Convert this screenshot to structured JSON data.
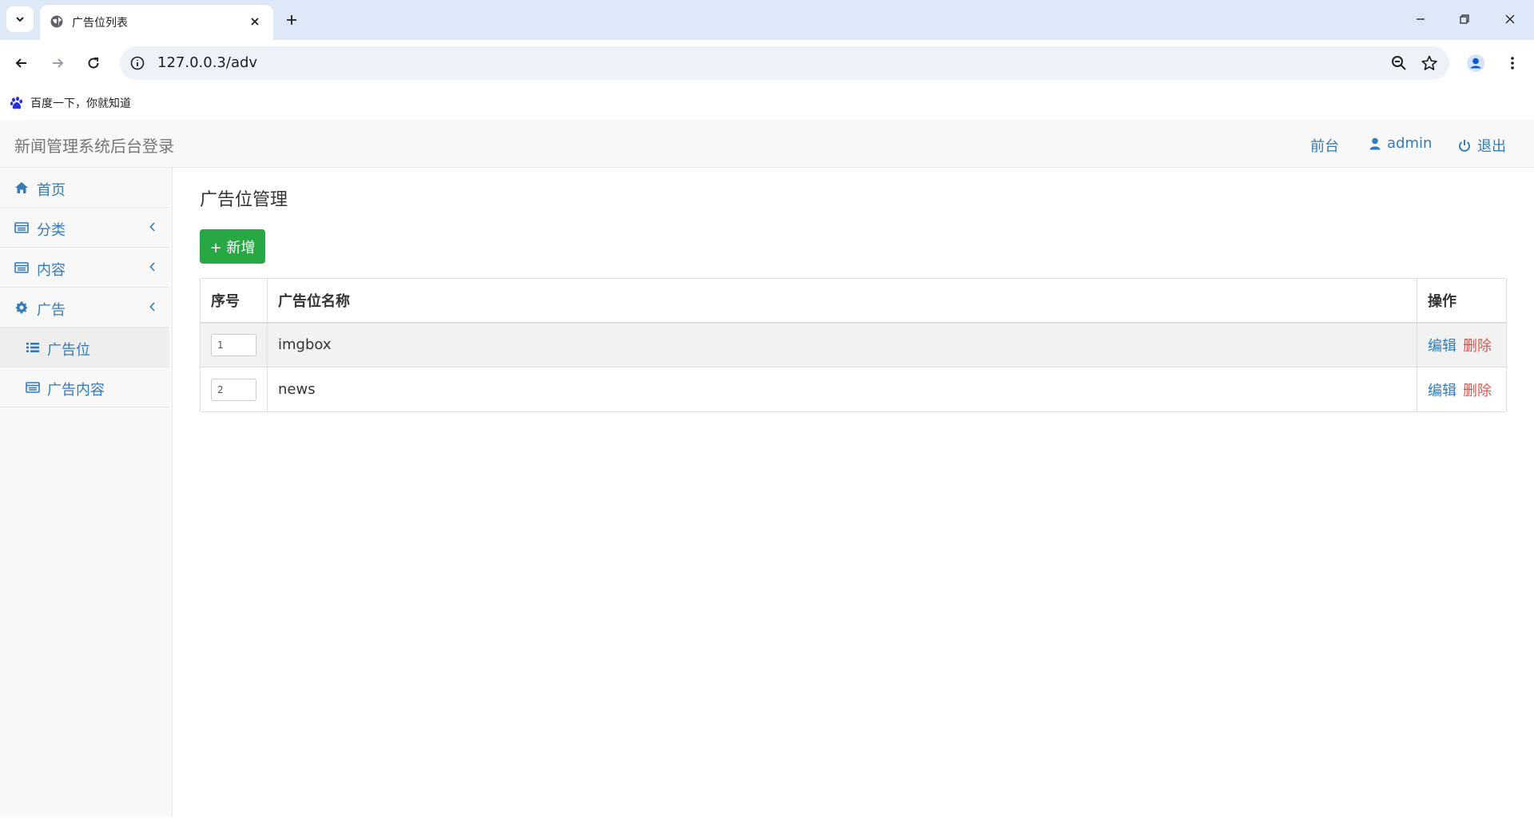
{
  "browser": {
    "tab_title": "广告位列表",
    "url": "127.0.0.3/adv",
    "bookmark_label": "百度一下，你就知道"
  },
  "app": {
    "brand": "新闻管理系统后台登录",
    "nav_right": {
      "frontend": "前台",
      "user": "admin",
      "logout": "退出"
    },
    "sidebar": {
      "items": [
        {
          "label": "首页",
          "icon": "home-icon"
        },
        {
          "label": "分类",
          "icon": "list-table-icon"
        },
        {
          "label": "内容",
          "icon": "list-table-icon"
        },
        {
          "label": "广告",
          "icon": "gear-icon"
        }
      ],
      "sub_items": [
        {
          "label": "广告位",
          "icon": "list-icon",
          "active": true
        },
        {
          "label": "广告内容",
          "icon": "list-table-icon",
          "active": false
        }
      ]
    },
    "main": {
      "title": "广告位管理",
      "add_button": "+ 新增",
      "table": {
        "headers": [
          "序号",
          "广告位名称",
          "操作"
        ],
        "rows": [
          {
            "order": "1",
            "name": "imgbox",
            "edit": "编辑",
            "delete": "删除"
          },
          {
            "order": "2",
            "name": "news",
            "edit": "编辑",
            "delete": "删除"
          }
        ]
      }
    }
  },
  "colors": {
    "link": "#337ab7",
    "danger": "#d9534f",
    "success": "#28a745"
  }
}
